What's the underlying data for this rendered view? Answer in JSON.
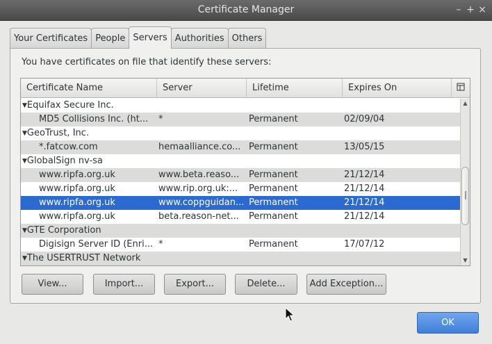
{
  "window": {
    "title": "Certificate Manager",
    "controls": [
      "–",
      "+",
      "×"
    ]
  },
  "tabs": [
    {
      "label": "Your Certificates",
      "active": false
    },
    {
      "label": "People",
      "active": false
    },
    {
      "label": "Servers",
      "active": true
    },
    {
      "label": "Authorities",
      "active": false
    },
    {
      "label": "Others",
      "active": false
    }
  ],
  "intro": "You have certificates on file that identify these servers:",
  "columns": {
    "name": "Certificate Name",
    "server": "Server",
    "lifetime": "Lifetime",
    "expires": "Expires On"
  },
  "groups": {
    "g1": "Equifax Secure Inc.",
    "g2": "GeoTrust, Inc.",
    "g3": "GlobalSign nv-sa",
    "g4": "GTE Corporation",
    "g5": "The USERTRUST Network"
  },
  "rows": [
    {
      "name": "MD5 Collisions Inc. (ht...",
      "server": "*",
      "lifetime": "Permanent",
      "expires": "02/09/04"
    },
    {
      "name": "*.fatcow.com",
      "server": "hemaalliance.co...",
      "lifetime": "Permanent",
      "expires": "13/05/15"
    },
    {
      "name": "www.ripfa.org.uk",
      "server": "www.beta.reaso...",
      "lifetime": "Permanent",
      "expires": "21/12/14"
    },
    {
      "name": "www.ripfa.org.uk",
      "server": "www.rip.org.uk:...",
      "lifetime": "Permanent",
      "expires": "21/12/14"
    },
    {
      "name": "www.ripfa.org.uk",
      "server": "www.coppguidan...",
      "lifetime": "Permanent",
      "expires": "21/12/14"
    },
    {
      "name": "www.ripfa.org.uk",
      "server": "beta.reason-net...",
      "lifetime": "Permanent",
      "expires": "21/12/14"
    },
    {
      "name": "Digisign Server ID (Enri...",
      "server": "*",
      "lifetime": "Permanent",
      "expires": "17/07/12"
    }
  ],
  "buttons": {
    "view": "View...",
    "import": "Import...",
    "export": "Export...",
    "delete": "Delete...",
    "add_exception": "Add Exception...",
    "ok": "OK"
  },
  "colors": {
    "selection": "#2b6ad0",
    "titlebar": "#4a4a4a",
    "ok_button": "#3f7ed9"
  }
}
